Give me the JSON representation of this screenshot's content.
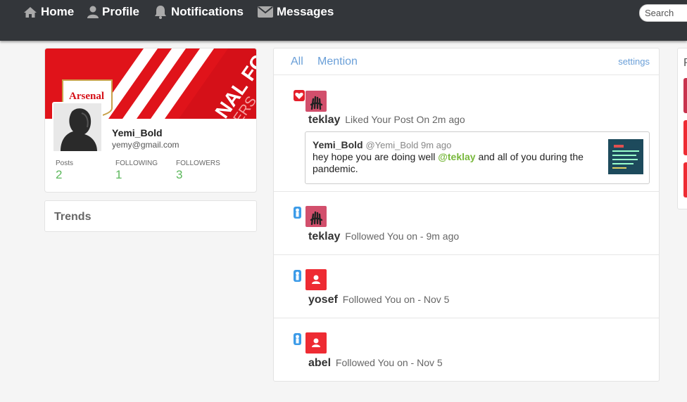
{
  "nav": {
    "items": [
      {
        "label": "Home",
        "icon": "home-icon"
      },
      {
        "label": "Profile",
        "icon": "user-icon"
      },
      {
        "label": "Notifications",
        "icon": "bell-icon"
      },
      {
        "label": "Messages",
        "icon": "envelope-icon"
      }
    ],
    "search_placeholder": "Search"
  },
  "profile": {
    "cover_text_1": "Arsenal",
    "cover_text_2": "NAL FC",
    "cover_text_3": "ERS",
    "username": "Yemi_Bold",
    "email": "yemy@gmail.com",
    "stats": [
      {
        "label": "Posts",
        "value": "2"
      },
      {
        "label": "FOLLOWING",
        "value": "1"
      },
      {
        "label": "FOLLOWERS",
        "value": "3"
      }
    ]
  },
  "trends": {
    "title": "Trends"
  },
  "notifications_panel": {
    "tabs": [
      "All",
      "Mention"
    ],
    "settings_label": "settings",
    "items": [
      {
        "type": "like",
        "user": "teklay",
        "text": "Liked Your Post On 2m ago"
      },
      {
        "type": "follow",
        "user": "teklay",
        "text": "Followed You on - 9m ago"
      },
      {
        "type": "follow",
        "user": "yosef",
        "text": "Followed You on - Nov 5"
      },
      {
        "type": "follow",
        "user": "abel",
        "text": "Followed You on - Nov 5"
      }
    ],
    "quoted_post": {
      "author": "Yemi_Bold",
      "handle_time": "@Yemi_Bold 9m ago",
      "text_before": "hey hope you are doing well ",
      "mention": "@teklay",
      "text_after": " and all of you during the pandemic."
    }
  },
  "right_card": {
    "title": "P"
  },
  "colors": {
    "navbar": "#33363a",
    "link_blue": "#6a9fd8",
    "stat_green": "#5cb85c",
    "mention_green": "#78b83c",
    "like_red": "#e41f2b",
    "follow_blue": "#3c9be8",
    "arsenal_red": "#e0131a"
  }
}
